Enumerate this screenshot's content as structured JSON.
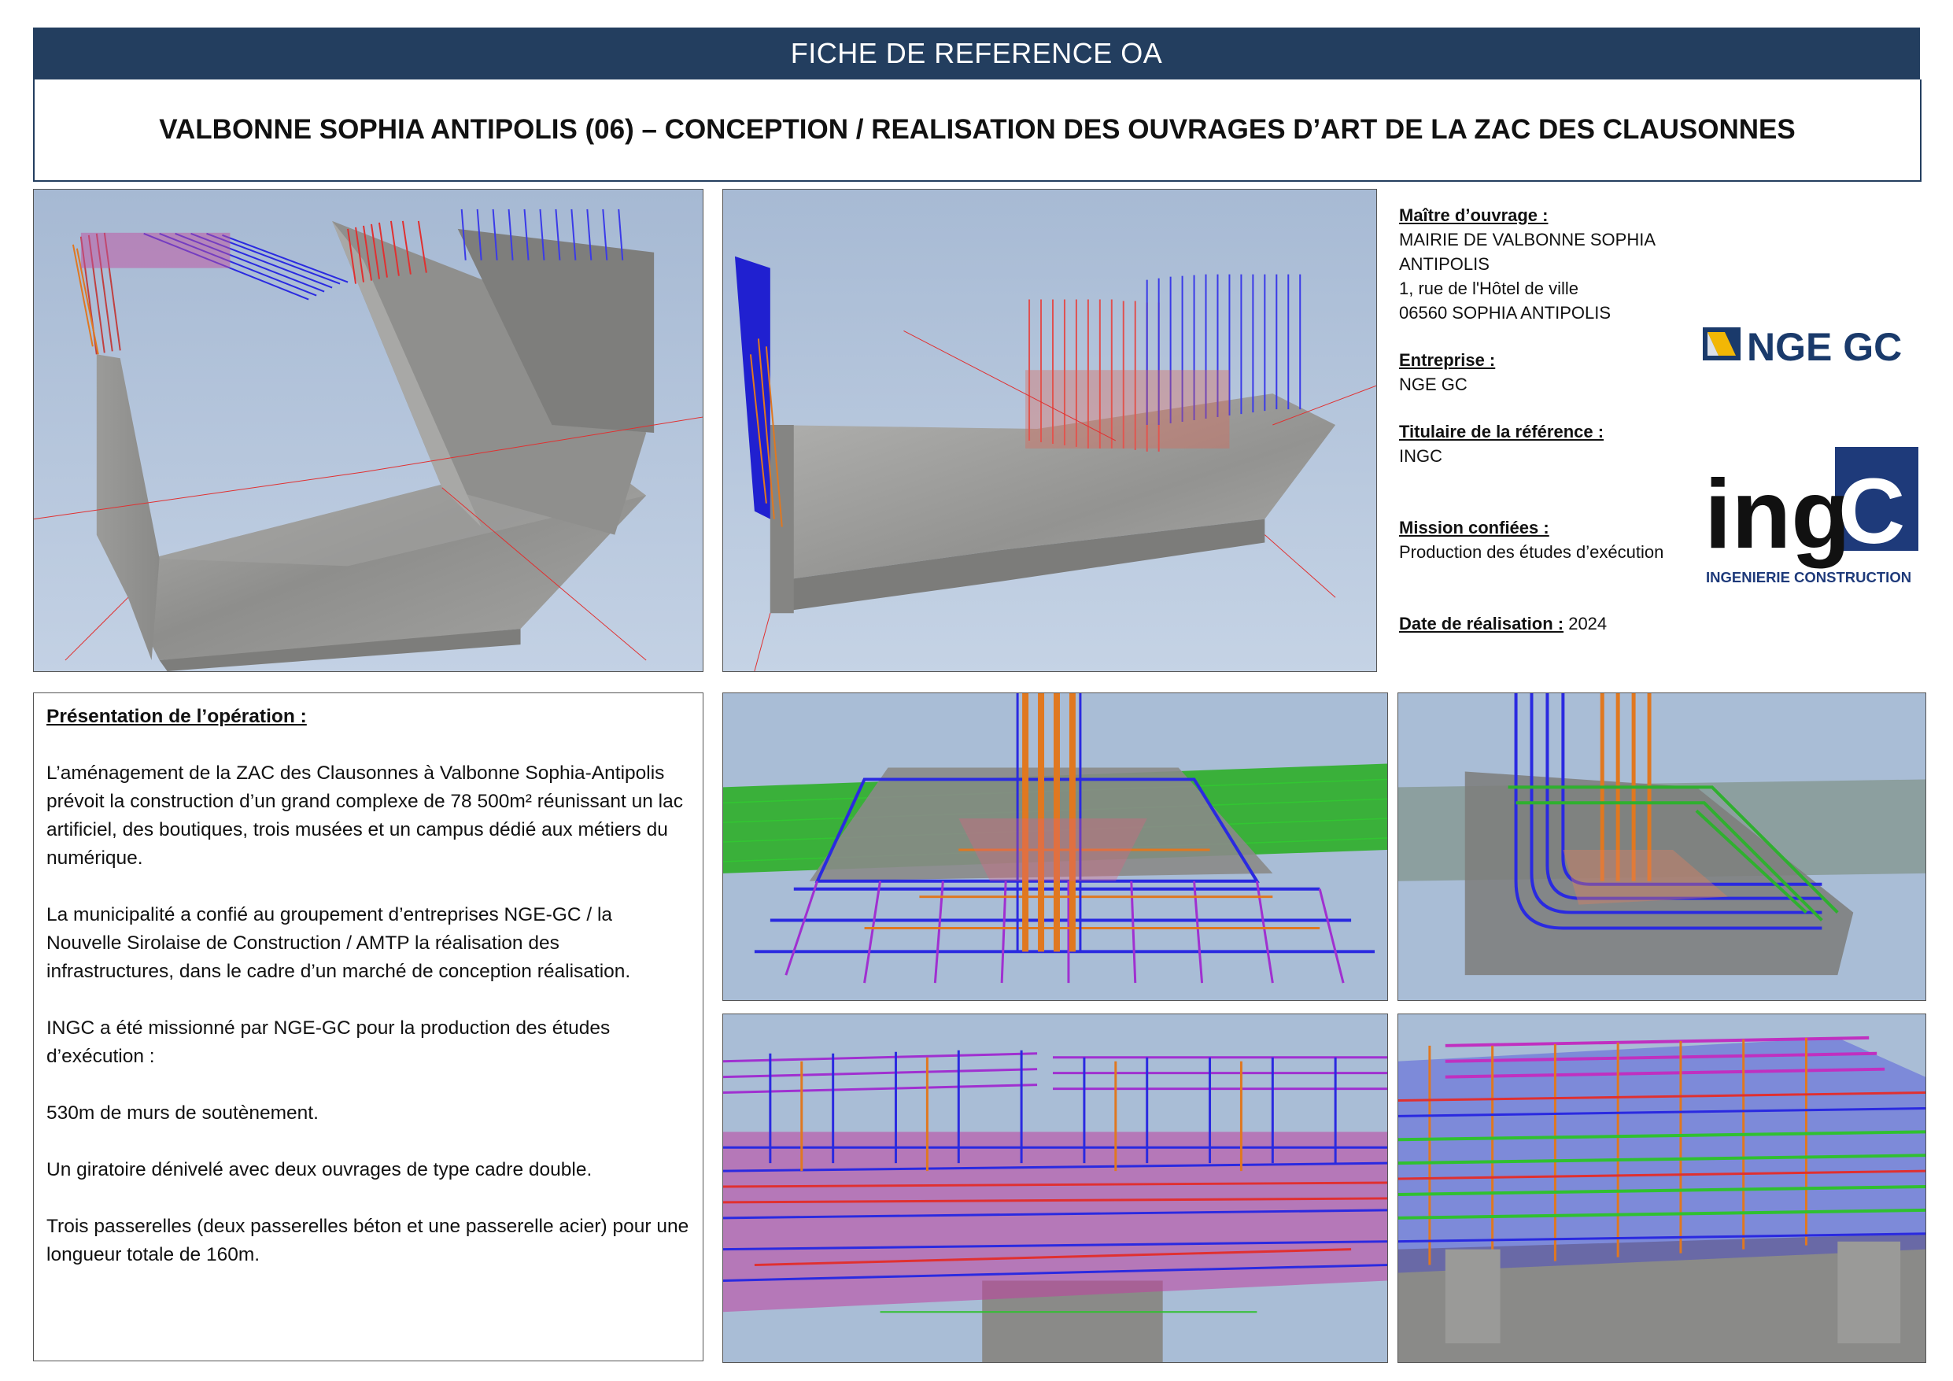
{
  "header": {
    "banner": "FICHE DE REFERENCE OA",
    "title": "VALBONNE SOPHIA ANTIPOLIS (06) – CONCEPTION / REALISATION DES OUVRAGES D’ART DE LA ZAC DES CLAUSONNES"
  },
  "info": {
    "maitre_label": "Maître d’ouvrage :",
    "maitre_lines": [
      "MAIRIE DE VALBONNE SOPHIA ANTIPOLIS",
      "1, rue de l'Hôtel de ville",
      "06560 SOPHIA ANTIPOLIS"
    ],
    "entreprise_label": "Entreprise :",
    "entreprise_value": "NGE GC",
    "titulaire_label": "Titulaire de la référence :",
    "titulaire_value": "INGC",
    "mission_label": "Mission confiées :",
    "mission_value": "Production des études d’exécution",
    "date_label": "Date de réalisation :",
    "date_value": "2024"
  },
  "logos": {
    "nge_text": "NGE GC",
    "ingc_text": "ingC",
    "ingc_sub": "INGENIERIE CONSTRUCTION"
  },
  "presentation": {
    "heading": "Présentation de l’opération :",
    "paragraphs": [
      "L’aménagement de la ZAC des Clausonnes à Valbonne Sophia-Antipolis prévoit la construction d’un grand complexe de 78 500m² réunissant un lac artificiel, des boutiques, trois musées et un campus dédié aux métiers du numérique.",
      "La municipalité a confié au groupement d’entreprises NGE-GC / la Nouvelle Sirolaise de Construction / AMTP la réalisation des infrastructures, dans le cadre d’un marché de conception réalisation.",
      "INGC a été missionné par NGE-GC pour la production des études d’exécution :",
      "530m de murs de soutènement.",
      "Un giratoire dénivelé avec deux ouvrages de type cadre double.",
      "Trois passerelles (deux passerelles béton et une passerelle acier) pour une longueur totale de 160m."
    ]
  },
  "colors": {
    "banner": "#233e5f",
    "sky": "#a9bdd6",
    "concrete": "#9a9a98",
    "rebar_blue": "#2a2ae0",
    "rebar_red": "#e03030",
    "rebar_orange": "#e07820",
    "rebar_purple": "#a030d0",
    "rebar_green": "#30c030",
    "nge_blue": "#1a3a6b",
    "nge_yellow": "#f2b705"
  }
}
